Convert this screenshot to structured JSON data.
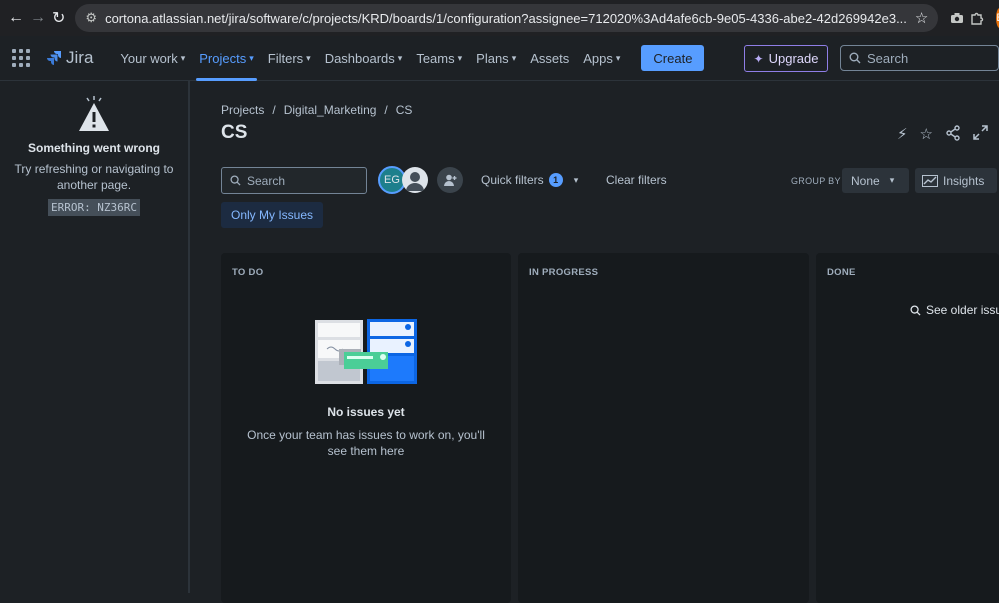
{
  "browser": {
    "url": "cortona.atlassian.net/jira/software/c/projects/KRD/boards/1/configuration?assignee=712020%3Ad4afe6cb-9e05-4336-abe2-42d269942e3...",
    "profile_initial": "E"
  },
  "topnav": {
    "logo_text": "Jira",
    "items": [
      {
        "label": "Your work"
      },
      {
        "label": "Projects"
      },
      {
        "label": "Filters"
      },
      {
        "label": "Dashboards"
      },
      {
        "label": "Teams"
      },
      {
        "label": "Plans"
      },
      {
        "label": "Assets"
      },
      {
        "label": "Apps"
      }
    ],
    "create_label": "Create",
    "upgrade_label": "Upgrade",
    "search_placeholder": "Search"
  },
  "sidebar": {
    "title": "Something went wrong",
    "message": "Try refreshing or navigating to another page.",
    "error_code": "ERROR: NZ36RC"
  },
  "breadcrumb": [
    "Projects",
    "/",
    "Digital_Marketing",
    "/",
    "CS"
  ],
  "page_title": "CS",
  "toolbar": {
    "search_placeholder": "Search",
    "avatar_initials": "EG",
    "quick_filters_label": "Quick filters",
    "quick_filters_count": "1",
    "clear_filters_label": "Clear filters",
    "group_by_label": "GROUP BY",
    "group_by_value": "None",
    "insights_label": "Insights",
    "only_my_issues_label": "Only My Issues"
  },
  "columns": [
    {
      "title": "TO DO",
      "empty_title": "No issues yet",
      "empty_message": "Once your team has issues to work on, you'll see them here"
    },
    {
      "title": "IN PROGRESS"
    },
    {
      "title": "DONE",
      "older_link": "See older issu"
    }
  ],
  "colors": {
    "accent": "#579dff",
    "background": "#1d2125",
    "column_bg": "#161a1d",
    "upgrade_border": "#8f7ee7"
  }
}
